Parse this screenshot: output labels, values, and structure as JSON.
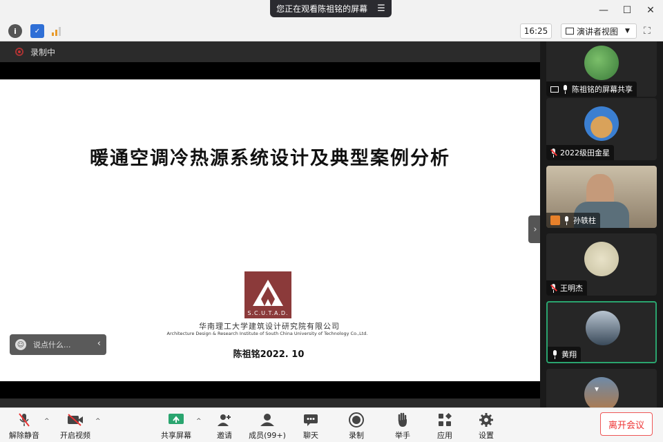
{
  "window": {
    "share_banner": "您正在观看陈祖铭的屏幕",
    "controls": [
      "minimize",
      "maximize",
      "close"
    ]
  },
  "toolbar": {
    "time": "16:25",
    "view_label": "演讲者视图"
  },
  "recording": {
    "label": "录制中"
  },
  "slide": {
    "title": "暖通空调冷热源系统设计及典型案例分析",
    "logo_text": "S.C.U.T.A.D.",
    "institute_cn": "华南理工大学建筑设计研究院有限公司",
    "institute_en": "Architecture Design & Research Institute of South China University of Technology Co.,Ltd.",
    "presenter": "陈祖铭2022. 10"
  },
  "chat": {
    "placeholder": "说点什么..."
  },
  "participants": [
    {
      "name": "陈祖铭的屏幕共享",
      "icon": "screen-share-icon",
      "mic": "on"
    },
    {
      "name": "2022级田金星",
      "icon": "mic-muted-icon",
      "mic": "muted"
    },
    {
      "name": "孙轶柱",
      "icon": "mic-icon",
      "mic": "on"
    },
    {
      "name": "王明杰",
      "icon": "mic-muted-icon",
      "mic": "muted"
    },
    {
      "name": "黄翔",
      "icon": "mic-icon",
      "mic": "on",
      "active": true
    },
    {
      "name": "",
      "icon": "",
      "mic": "on"
    }
  ],
  "bottom_bar": {
    "unmute": "解除静音",
    "start_video": "开启视频",
    "share_screen": "共享屏幕",
    "invite": "邀请",
    "members": "成员(99+)",
    "chat": "聊天",
    "record": "录制",
    "raise_hand": "举手",
    "apps": "应用",
    "settings": "设置",
    "leave": "离开会议"
  },
  "colors": {
    "accent_green": "#2aa56f",
    "leave_red": "#e33333",
    "logo_red": "#8b3a3a"
  }
}
